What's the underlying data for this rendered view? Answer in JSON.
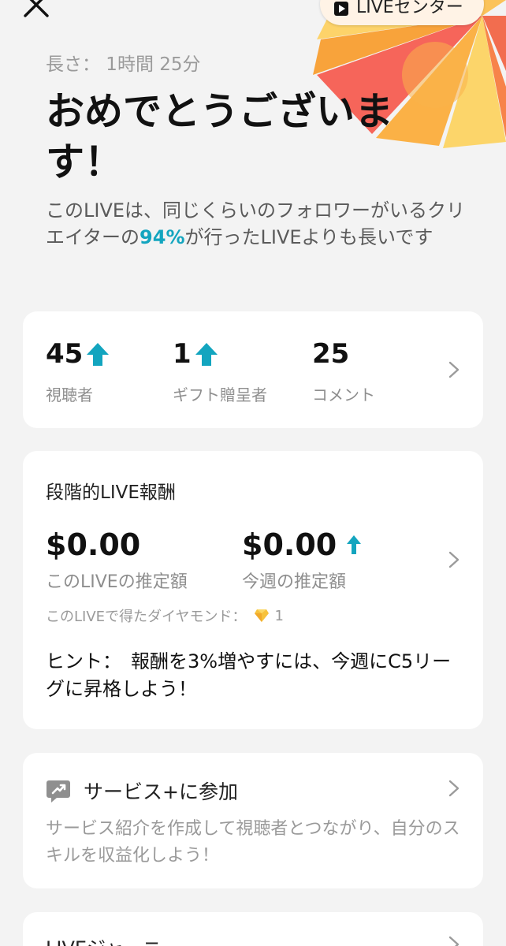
{
  "colors": {
    "accent": "#13a5bf",
    "background": "#f3f3f3"
  },
  "top_bar": {
    "close_icon": "close-icon",
    "live_center_label": "LIVEセンター"
  },
  "summary": {
    "duration": "長さ： 1時間 25分",
    "title": "おめでとうございます！",
    "compare_prefix": "このLIVEは、同じくらいのフォロワーがいるクリエイターの",
    "compare_highlight": "94%",
    "compare_suffix": "が行ったLIVEよりも長いです"
  },
  "stats": [
    {
      "value": "45",
      "label": "視聴者",
      "trend": "up"
    },
    {
      "value": "1",
      "label": "ギフト贈呈者",
      "trend": "up"
    },
    {
      "value": "25",
      "label": "コメント",
      "trend": "none"
    }
  ],
  "rewards": {
    "title": "段階的LIVE報酬",
    "this_live_amount": "$0.00",
    "this_live_label": "このLIVEの推定額",
    "this_week_amount": "$0.00",
    "this_week_label": "今週の推定額",
    "diamonds_label": "このLIVEで得たダイヤモンド：",
    "diamonds_count": "1",
    "hint": "ヒント：　報酬を3%増やすには、今週にC5リーグに昇格しよう！"
  },
  "service": {
    "title": "サービス+に参加",
    "description": "サービス紹介を作成して視聴者とつながり、自分のスキルを収益化しよう！"
  },
  "journey": {
    "title": "LIVEジャーニー"
  }
}
